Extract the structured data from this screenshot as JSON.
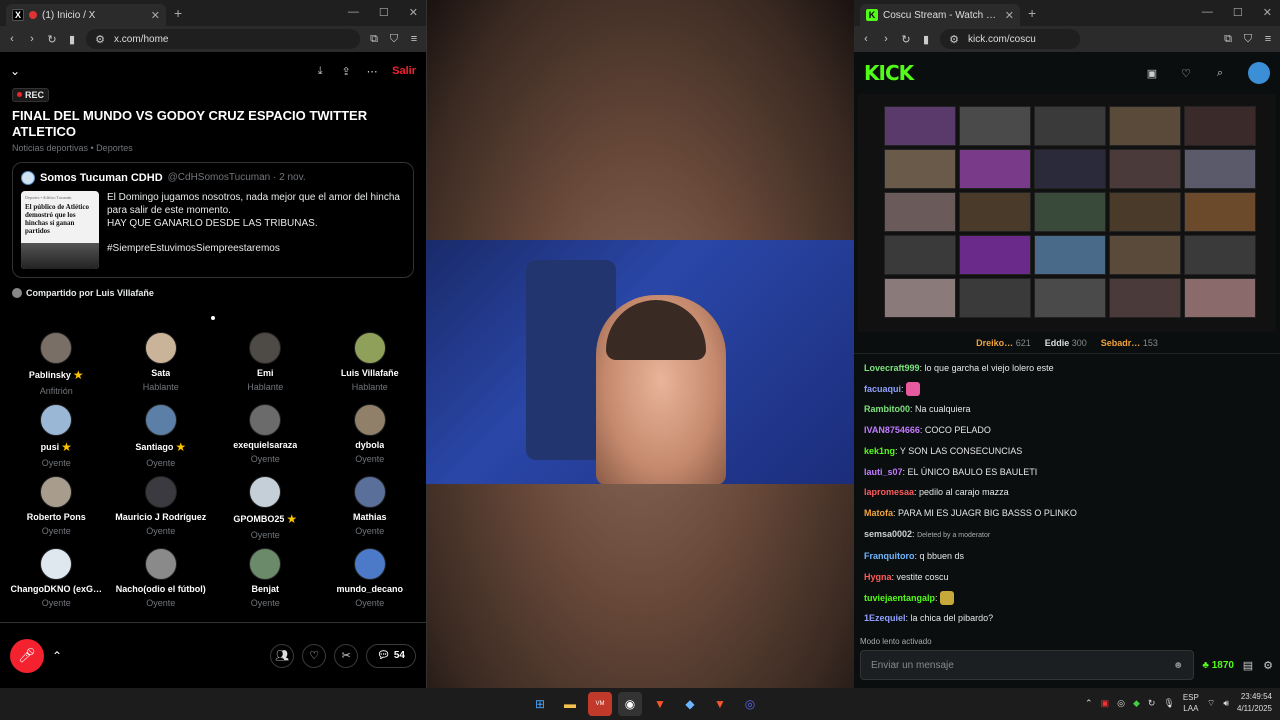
{
  "left_window": {
    "tab_title": "(1) Inicio / X",
    "url": "x.com/home",
    "space": {
      "leave_label": "Salir",
      "rec_label": "REC",
      "title": "FINAL DEL MUNDO VS GODOY CRUZ ESPACIO TWITTER ATLETICO",
      "subtitle": "Noticias deportivas • Deportes",
      "tweet": {
        "author": "Somos Tucuman CDHD",
        "handle_date": "@CdHSomosTucuman · 2 nov.",
        "image_header": "Deportes • Atlético Tucumán",
        "image_headline": "El público de Atlético demostró que los hinchas sí ganan partidos",
        "lines": [
          "El Domingo jugamos nosotros, nada mejor que el amor del hincha para salir de este momento.",
          "HAY QUE GANARLO DESDE LAS TRIBUNAS.",
          "#SiempreEstuvimosSiempreestaremos"
        ]
      },
      "shared_by": "Compartido por Luis Villafañe",
      "participants": [
        {
          "name": "Pablinsky",
          "star": true,
          "role": "Anfitrión"
        },
        {
          "name": "Sata",
          "star": false,
          "role": "Hablante"
        },
        {
          "name": "Emi",
          "star": false,
          "role": "Hablante"
        },
        {
          "name": "Luis Villafañe",
          "star": false,
          "role": "Hablante"
        },
        {
          "name": "pusi",
          "star": true,
          "role": "Oyente"
        },
        {
          "name": "Santiago",
          "star": true,
          "role": "Oyente"
        },
        {
          "name": "exequielsaraza",
          "star": false,
          "role": "Oyente"
        },
        {
          "name": "dybola",
          "star": false,
          "role": "Oyente"
        },
        {
          "name": "Roberto Pons",
          "star": false,
          "role": "Oyente"
        },
        {
          "name": "Mauricio J Rodríguez",
          "star": false,
          "role": "Oyente"
        },
        {
          "name": "GPOMBO25",
          "star": true,
          "role": "Oyente"
        },
        {
          "name": "Mathias",
          "star": false,
          "role": "Oyente"
        },
        {
          "name": "ChangoDKNO (exG…",
          "star": false,
          "role": "Oyente"
        },
        {
          "name": "Nacho(odio el fútbol)",
          "star": false,
          "role": "Oyente"
        },
        {
          "name": "Benjat",
          "star": false,
          "role": "Oyente"
        },
        {
          "name": "mundo_decano",
          "star": false,
          "role": "Oyente"
        }
      ],
      "comment_count": "54"
    }
  },
  "right_window": {
    "tab_title": "Coscu Stream - Watch Live on Kick",
    "url": "kick.com/coscu",
    "logo": "KICK",
    "hosts": [
      {
        "name": "Dreiko…",
        "count": "621"
      },
      {
        "name": "Eddie",
        "count": "300"
      },
      {
        "name": "Sebadr…",
        "count": "153"
      }
    ],
    "chat": [
      {
        "user": "Lovecraft999",
        "color": "#7be37b",
        "text": "lo que garcha el viejo lolero este"
      },
      {
        "user": "facuaqui",
        "color": "#8fa0ff",
        "text": "",
        "emote": "#e85aa0"
      },
      {
        "user": "Rambito00",
        "color": "#7be37b",
        "text": "Na cualquiera"
      },
      {
        "user": "IVAN8754666",
        "color": "#c27bff",
        "text": "COCO PELADO"
      },
      {
        "user": "kek1ng",
        "color": "#53fc18",
        "text": "Y SON LAS CONSECUNCIAS"
      },
      {
        "user": "lauti_s07",
        "color": "#c27bff",
        "text": "EL ÚNICO BAULO ES BAULETI"
      },
      {
        "user": "lapromesaa",
        "color": "#ff5a5a",
        "text": "pedilo al carajo mazza"
      },
      {
        "user": "Matofa",
        "color": "#f2a33a",
        "text": "PARA MI ES JUAGR BIG BASSS O PLINKO"
      },
      {
        "user": "semsa0002",
        "color": "#cfcfcf",
        "text": "",
        "deleted": "Deleted by a moderator"
      },
      {
        "user": "Franquitoro",
        "color": "#6fb6ff",
        "text": "q bbuen ds"
      },
      {
        "user": "Hygna",
        "color": "#ff5a5a",
        "text": "vestite coscu"
      },
      {
        "user": "tuviejaentangalp",
        "color": "#53fc18",
        "text": "",
        "emote": "#c7a83a"
      },
      {
        "user": "1Ezequiel",
        "color": "#8fa0ff",
        "text": "la chica del pibardo?"
      }
    ],
    "slow_mode": "Modo lento activado",
    "input_placeholder": "Enviar un mensaje",
    "points": "1870"
  },
  "taskbar": {
    "lang_top": "ESP",
    "lang_bottom": "LAA",
    "time": "23:49:54",
    "date": "4/11/2025"
  }
}
